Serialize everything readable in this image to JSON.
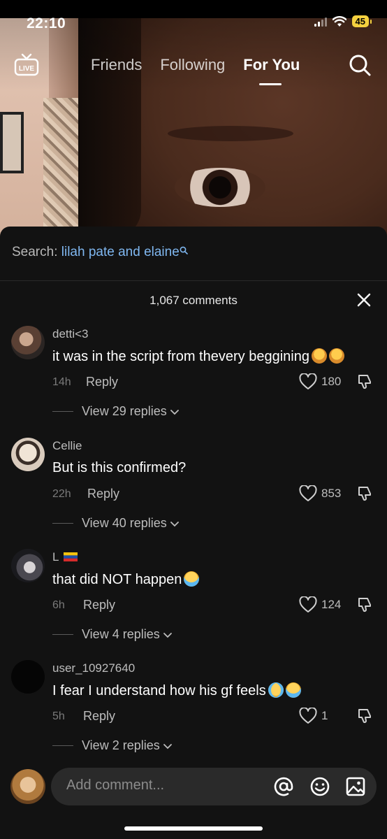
{
  "status_bar": {
    "time": "22:10",
    "battery": "45"
  },
  "top_nav": {
    "live_label": "LIVE",
    "tabs": [
      {
        "label": "Friends",
        "active": false
      },
      {
        "label": "Following",
        "active": false
      },
      {
        "label": "For You",
        "active": true
      }
    ]
  },
  "search_suggestion": {
    "prefix": "Search:",
    "query": "lilah pate and elaine"
  },
  "comments_header": {
    "count_label": "1,067 comments"
  },
  "comments": [
    {
      "username": "detti<3",
      "text": "it was in the script from thevery beggining",
      "emojis": [
        "woman-facepalming",
        "woman-facepalming"
      ],
      "time": "14h",
      "reply_label": "Reply",
      "likes": "180",
      "view_replies": "View 29 replies"
    },
    {
      "username": "Cellie",
      "text": "But is this confirmed?",
      "emojis": [],
      "time": "22h",
      "reply_label": "Reply",
      "likes": "853",
      "view_replies": "View 40 replies"
    },
    {
      "username": "L",
      "username_flag": "venezuela-flag",
      "text": "that did NOT happen",
      "emojis": [
        "loudly-crying-face"
      ],
      "time": "6h",
      "reply_label": "Reply",
      "likes": "124",
      "view_replies": "View 4 replies"
    },
    {
      "username": "user_10927640",
      "text": "I fear I understand how his gf feels",
      "emojis": [
        "tears-of-joy-face",
        "loudly-crying-face"
      ],
      "time": "5h",
      "reply_label": "Reply",
      "likes": "1",
      "view_replies": "View 2 replies"
    }
  ],
  "comment_input": {
    "placeholder": "Add comment..."
  },
  "colors": {
    "sheet_bg": "#121212",
    "link": "#7fb7f0",
    "battery": "#f4d03f"
  }
}
